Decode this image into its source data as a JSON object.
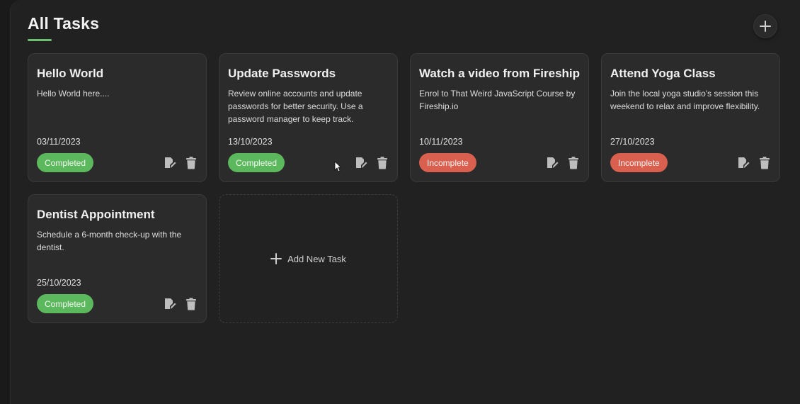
{
  "page": {
    "title": "All Tasks",
    "add_button_icon": "plus-icon"
  },
  "colors": {
    "accent": "#6fbf73",
    "completed": "#5cb85c",
    "incomplete": "#d9604f"
  },
  "tasks": [
    {
      "title": "Hello World",
      "description": "Hello World here....",
      "date": "03/11/2023",
      "status": "Completed"
    },
    {
      "title": "Update Passwords",
      "description": "Review online accounts and update passwords for better security. Use a password manager to keep track.",
      "date": "13/10/2023",
      "status": "Completed"
    },
    {
      "title": "Watch a video from Fireship",
      "description": "Enrol to That Weird JavaScript Course by Fireship.io",
      "date": "10/11/2023",
      "status": "Incomplete"
    },
    {
      "title": "Attend Yoga Class",
      "description": "Join the local yoga studio's session this weekend to relax and improve flexibility.",
      "date": "27/10/2023",
      "status": "Incomplete"
    },
    {
      "title": "Dentist Appointment",
      "description": "Schedule a 6-month check-up with the dentist.",
      "date": "25/10/2023",
      "status": "Completed"
    }
  ],
  "add_card": {
    "label": "Add New Task",
    "icon": "plus-icon"
  },
  "icons": {
    "edit": "edit-icon",
    "delete": "trash-icon"
  }
}
